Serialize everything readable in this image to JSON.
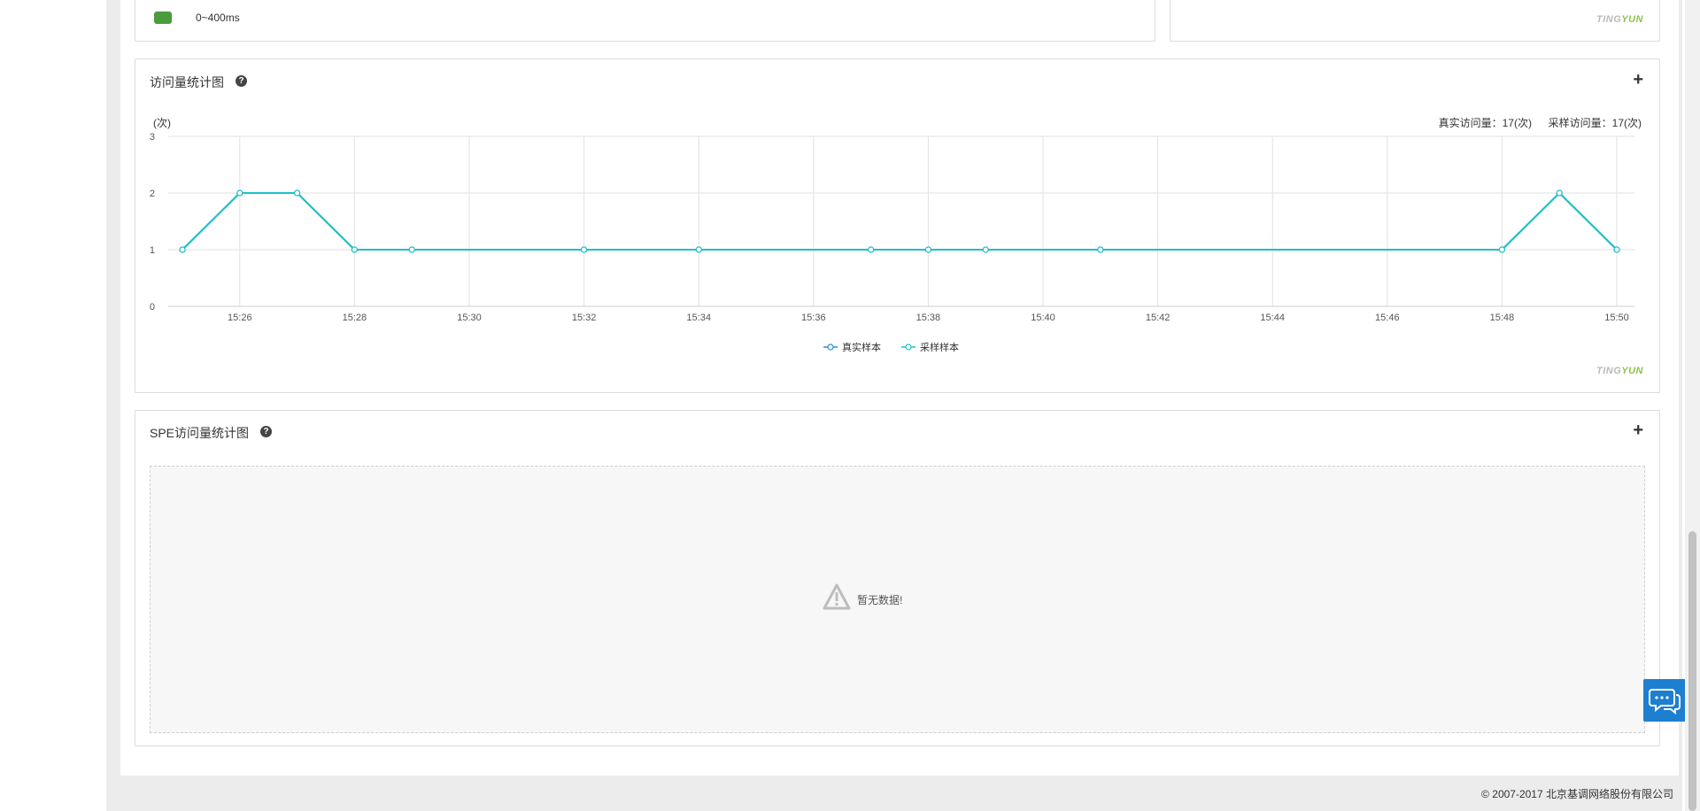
{
  "top_panel": {
    "legend_item_label": "0~400ms",
    "legend_item_color": "#4a9c3d"
  },
  "watermark": {
    "part1": "TING",
    "part2": "YUN"
  },
  "visits_panel": {
    "title": "访问量统计图",
    "help_icon": "question-circle-icon",
    "expand_icon": "plus-icon",
    "unit_label": "(次)",
    "real_label": "真实访问量：",
    "real_value": "17(次)",
    "sample_label": "采样访问量：",
    "sample_value": "17(次)"
  },
  "chart_data": {
    "type": "line",
    "ylim": [
      0,
      3
    ],
    "yticks": [
      "0",
      "1",
      "2",
      "3"
    ],
    "xticks": [
      "15:26",
      "15:28",
      "15:30",
      "15:32",
      "15:34",
      "15:36",
      "15:38",
      "15:40",
      "15:42",
      "15:44",
      "15:46",
      "15:48",
      "15:50"
    ],
    "xlim": [
      "15:25",
      "15:50"
    ],
    "series": [
      {
        "name": "真实样本",
        "color": "#2a8fd0",
        "points": [
          {
            "x": "15:25",
            "y": 1
          },
          {
            "x": "15:26",
            "y": 2
          },
          {
            "x": "15:27",
            "y": 2
          },
          {
            "x": "15:28",
            "y": 1
          },
          {
            "x": "15:29",
            "y": 1
          },
          {
            "x": "15:32",
            "y": 1
          },
          {
            "x": "15:34",
            "y": 1
          },
          {
            "x": "15:37",
            "y": 1
          },
          {
            "x": "15:38",
            "y": 1
          },
          {
            "x": "15:39",
            "y": 1
          },
          {
            "x": "15:41",
            "y": 1
          },
          {
            "x": "15:48",
            "y": 1
          },
          {
            "x": "15:49",
            "y": 2
          },
          {
            "x": "15:50",
            "y": 1
          }
        ]
      },
      {
        "name": "采样样本",
        "color": "#1fc0c9",
        "points": [
          {
            "x": "15:25",
            "y": 1
          },
          {
            "x": "15:26",
            "y": 2
          },
          {
            "x": "15:27",
            "y": 2
          },
          {
            "x": "15:28",
            "y": 1
          },
          {
            "x": "15:29",
            "y": 1
          },
          {
            "x": "15:32",
            "y": 1
          },
          {
            "x": "15:34",
            "y": 1
          },
          {
            "x": "15:37",
            "y": 1
          },
          {
            "x": "15:38",
            "y": 1
          },
          {
            "x": "15:39",
            "y": 1
          },
          {
            "x": "15:41",
            "y": 1
          },
          {
            "x": "15:48",
            "y": 1
          },
          {
            "x": "15:49",
            "y": 2
          },
          {
            "x": "15:50",
            "y": 1
          }
        ]
      }
    ],
    "grid": true,
    "legend_position": "bottom-center"
  },
  "spe_panel": {
    "title": "SPE访问量统计图",
    "help_icon": "question-circle-icon",
    "expand_icon": "plus-icon",
    "empty_icon": "warning-triangle-icon",
    "empty_text": "暂无数据!"
  },
  "chat_button": {
    "icon": "chat-bubbles-icon"
  },
  "footer": {
    "copyright": "© 2007-2017  北京基调网络股份有限公司"
  }
}
